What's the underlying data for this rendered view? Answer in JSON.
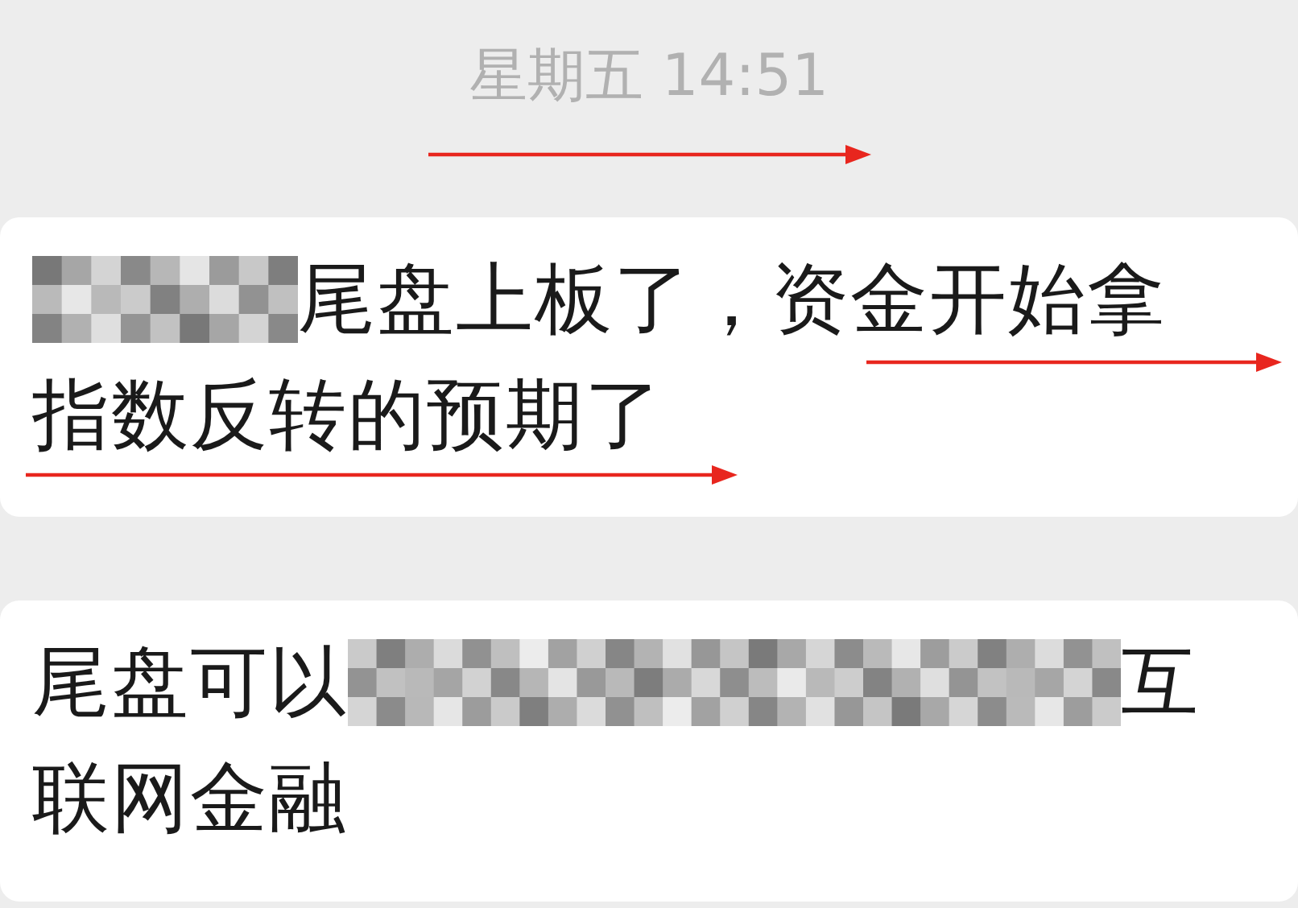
{
  "timestamp": {
    "text": "星期五 14:51",
    "arrow": true
  },
  "messages": [
    {
      "lines": [
        {
          "parts": [
            {
              "kind": "redacted",
              "wide": false
            },
            {
              "kind": "text",
              "text": "尾盘上板了，资金开始拿"
            }
          ],
          "arrow": true,
          "arrow_at_start": false
        },
        {
          "parts": [
            {
              "kind": "text",
              "text": "指数反转的预期了"
            }
          ],
          "arrow": true,
          "arrow_at_start": true
        }
      ]
    },
    {
      "lines": [
        {
          "parts": [
            {
              "kind": "text",
              "text": "尾盘可以"
            },
            {
              "kind": "redacted",
              "wide": true
            },
            {
              "kind": "text",
              "text": "互"
            }
          ]
        },
        {
          "parts": [
            {
              "kind": "text",
              "text": "联网金融"
            }
          ]
        }
      ]
    }
  ]
}
